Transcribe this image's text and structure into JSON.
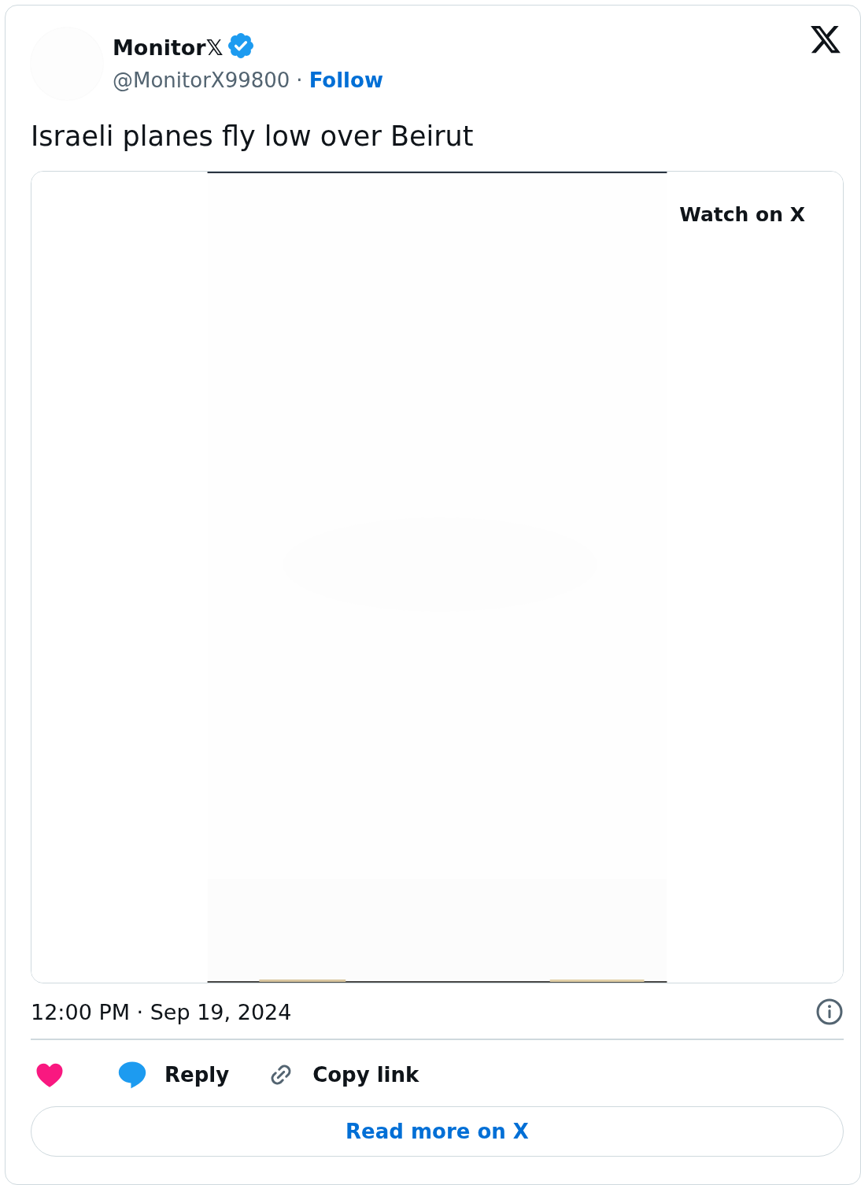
{
  "author": {
    "name": "Monitor𝕏",
    "verified": true,
    "handle": "@MonitorX99800",
    "separator": "·",
    "follow": "Follow"
  },
  "text": "Israeli planes fly low over Beirut",
  "media": {
    "kind": "picture",
    "overlay": "Watch on X"
  },
  "timestamp": "12:00 PM · Sep 19, 2024",
  "actions": [
    {
      "kind": "like"
    },
    {
      "kind": "reply",
      "label": "Reply"
    },
    {
      "kind": "copy",
      "label": "Copy link"
    }
  ],
  "read_more": "Read more on X"
}
